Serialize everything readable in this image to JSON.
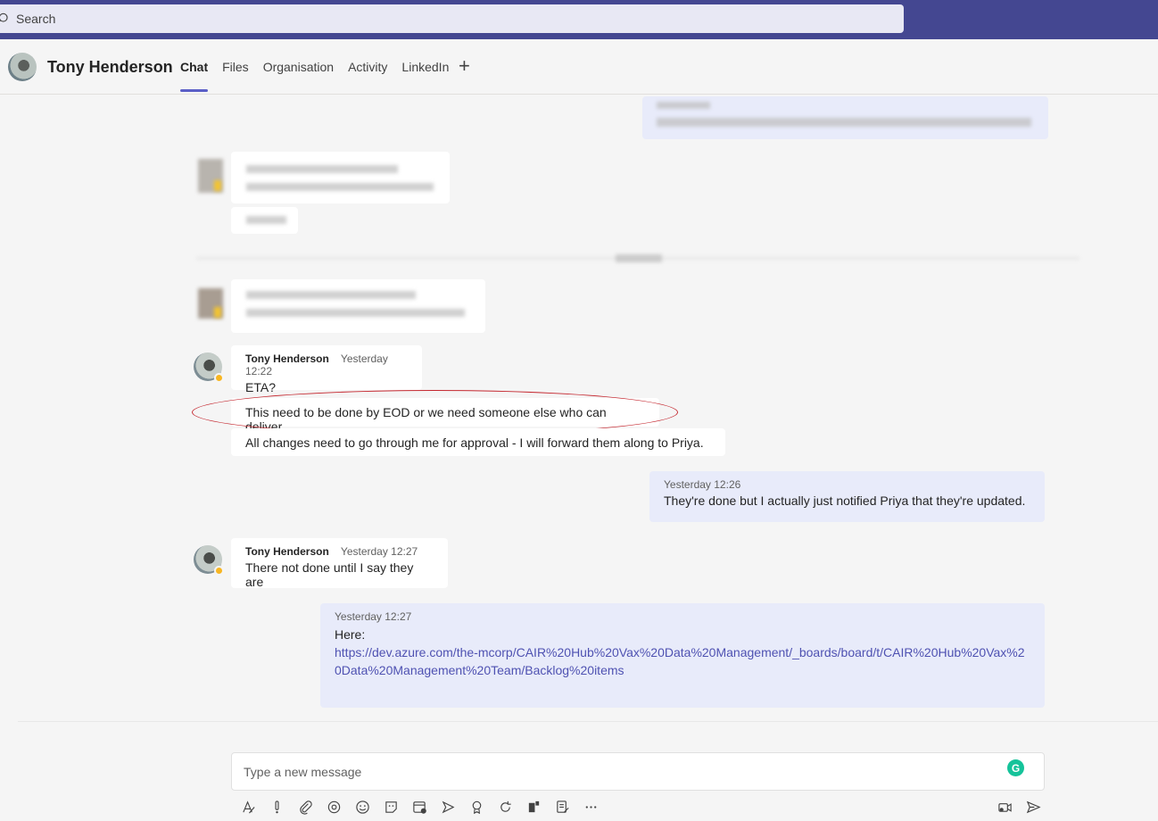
{
  "search": {
    "placeholder": "Search"
  },
  "header": {
    "name": "Tony Henderson",
    "tabs": [
      {
        "label": "Chat",
        "active": true
      },
      {
        "label": "Files"
      },
      {
        "label": "Organisation"
      },
      {
        "label": "Activity"
      },
      {
        "label": "LinkedIn"
      }
    ],
    "add_icon": "plus-icon"
  },
  "messages": [
    {
      "author": "Tony Henderson",
      "time": "Yesterday 12:22",
      "text": "ETA?"
    },
    {
      "text": "This need to be done by EOD or we need someone else who can deliver",
      "highlighted": true
    },
    {
      "text": "All changes need to go through me for approval - I will forward them along to Priya."
    },
    {
      "time": "Yesterday 12:26",
      "text": "They're done but I actually just notified Priya that they're updated.",
      "mine": true
    },
    {
      "author": "Tony Henderson",
      "time": "Yesterday 12:27",
      "text": "There not done until I say they are"
    },
    {
      "time": "Yesterday 12:27",
      "text": "Here:",
      "link": "https://dev.azure.com/the-mcorp/CAIR%20Hub%20Vax%20Data%20Management/_boards/board/t/CAIR%20Hub%20Vax%20Data%20Management%20Team/Backlog%20items",
      "mine": true
    }
  ],
  "compose": {
    "placeholder": "Type a new message",
    "grammarly_letter": "G"
  },
  "colors": {
    "brand": "#444791",
    "accent": "#5b5fc7",
    "my_bubble": "#e8ebfa",
    "annotation": "#c4262e",
    "presence_away": "#f8b622"
  }
}
